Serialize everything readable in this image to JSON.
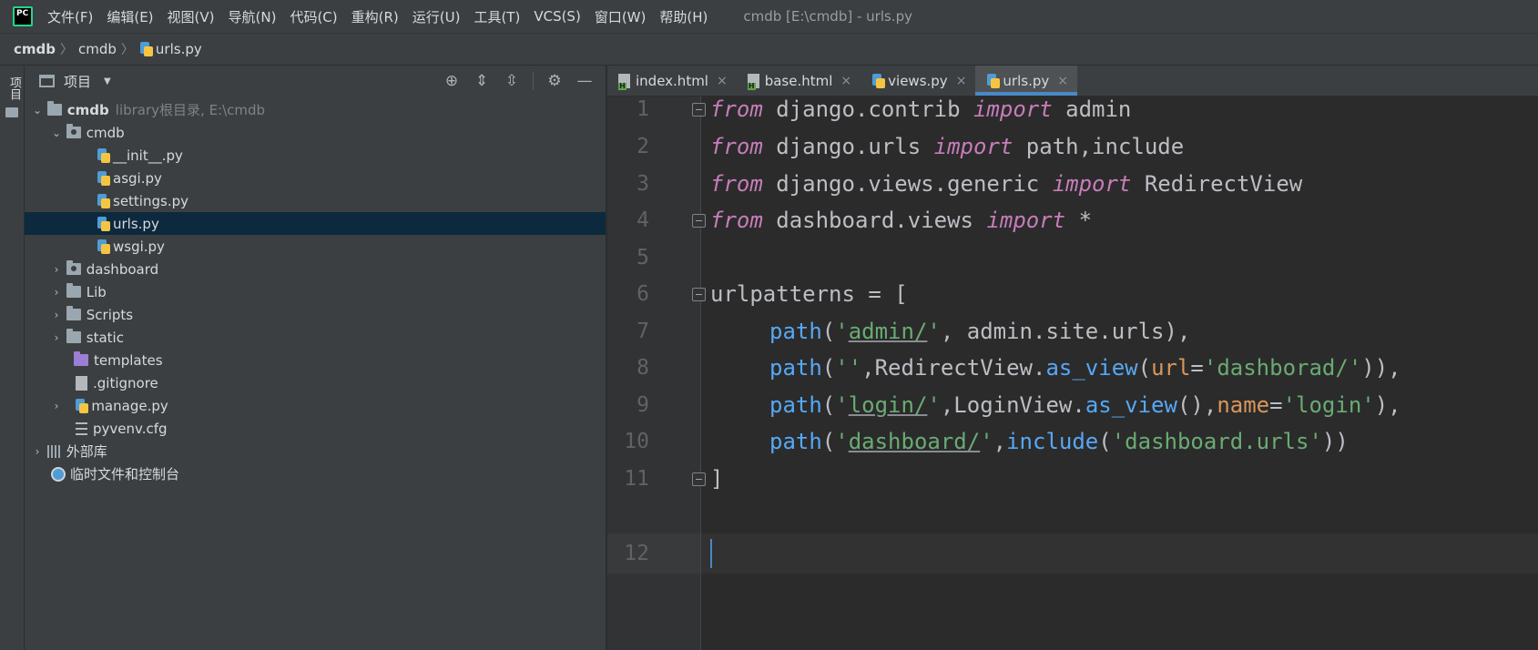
{
  "menubar": {
    "logo": "PC",
    "items": [
      "文件(F)",
      "编辑(E)",
      "视图(V)",
      "导航(N)",
      "代码(C)",
      "重构(R)",
      "运行(U)",
      "工具(T)",
      "VCS(S)",
      "窗口(W)",
      "帮助(H)"
    ],
    "window_title": "cmdb [E:\\cmdb] - urls.py"
  },
  "breadcrumb": [
    "cmdb",
    "cmdb",
    "urls.py"
  ],
  "left_strip": {
    "project_tab": "项目"
  },
  "project_panel": {
    "title": "项目",
    "header_icons": [
      "locate-icon",
      "expand-all-icon",
      "collapse-all-icon",
      "gear-icon",
      "minimize-icon"
    ],
    "tree": [
      {
        "label": "cmdb",
        "hint": "library根目录,  E:\\cmdb"
      },
      {
        "label": "cmdb"
      },
      {
        "label": "__init__.py"
      },
      {
        "label": "asgi.py"
      },
      {
        "label": "settings.py"
      },
      {
        "label": "urls.py"
      },
      {
        "label": "wsgi.py"
      },
      {
        "label": "dashboard"
      },
      {
        "label": "Lib"
      },
      {
        "label": "Scripts"
      },
      {
        "label": "static"
      },
      {
        "label": "templates"
      },
      {
        "label": ".gitignore"
      },
      {
        "label": "manage.py"
      },
      {
        "label": "pyvenv.cfg"
      },
      {
        "label": "外部库"
      },
      {
        "label": "临时文件和控制台"
      }
    ]
  },
  "editor": {
    "tabs": [
      {
        "label": "index.html",
        "close": "×"
      },
      {
        "label": "base.html",
        "close": "×"
      },
      {
        "label": "views.py",
        "close": "×"
      },
      {
        "label": "urls.py",
        "close": "×"
      }
    ],
    "line_numbers": [
      "1",
      "2",
      "3",
      "4",
      "5",
      "6",
      "7",
      "8",
      "9",
      "10",
      "11",
      "12"
    ],
    "code": {
      "l1": [
        "from",
        " django.contrib ",
        "import",
        " admin"
      ],
      "l2": [
        "from",
        " django.urls ",
        "import",
        " path,include"
      ],
      "l3": [
        "from",
        " django.views.generic ",
        "import",
        " RedirectView"
      ],
      "l4": [
        "from",
        " dashboard.views ",
        "import",
        " *"
      ],
      "l6": "urlpatterns = [",
      "l7": [
        "path",
        "(",
        "'",
        "admin/",
        "'",
        ", admin.site.urls),"
      ],
      "l8": [
        "path",
        "(",
        "''",
        ",RedirectView.",
        "as_view",
        "(",
        "url",
        "=",
        "'dashborad/'",
        ")),"
      ],
      "l9": [
        "path",
        "(",
        "'",
        "login/",
        "'",
        ",LoginView.",
        "as_view",
        "(),",
        "name",
        "=",
        "'login'",
        "),"
      ],
      "l10": [
        "path",
        "(",
        "'",
        "dashboard/",
        "'",
        ",",
        "include",
        "(",
        "'dashboard.urls'",
        "))"
      ],
      "l11": "]"
    }
  }
}
